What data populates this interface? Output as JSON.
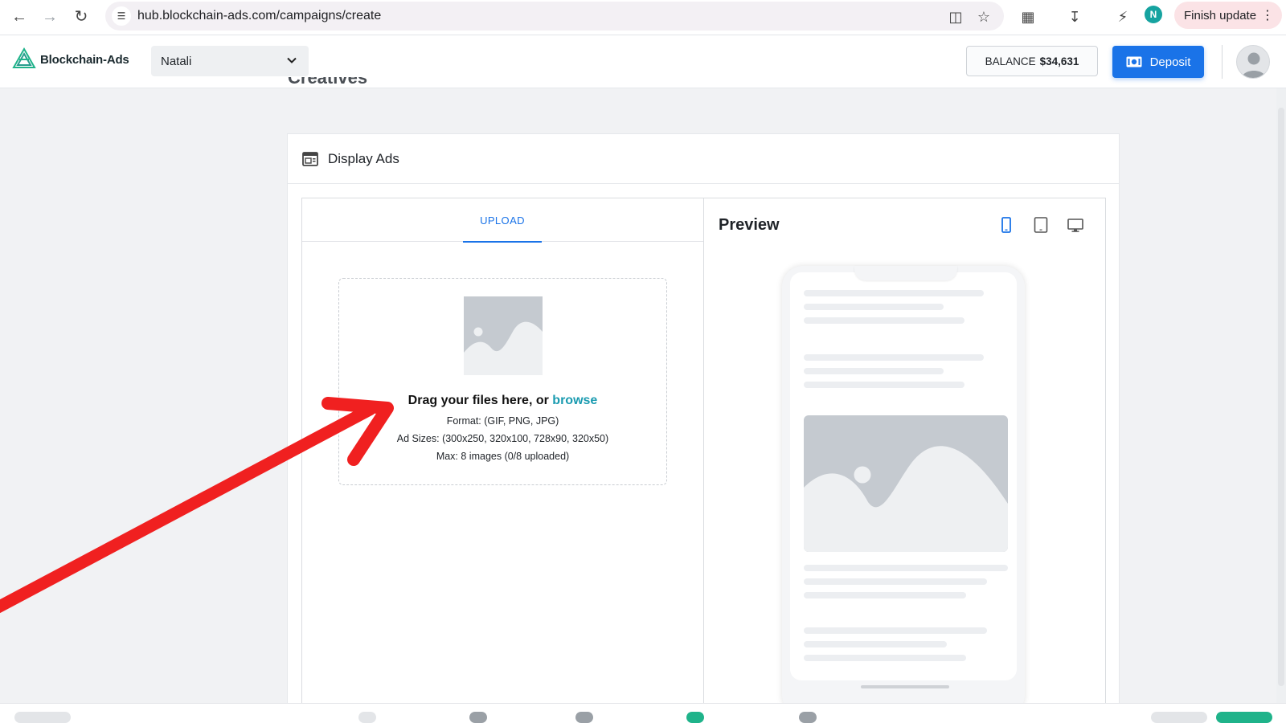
{
  "browser": {
    "url": "hub.blockchain-ads.com/campaigns/create",
    "profile_initial": "N",
    "finish_update_label": "Finish update"
  },
  "header": {
    "brand": "Blockchain-Ads",
    "account": "Natali",
    "balance_label": "BALANCE",
    "balance_value": "$34,631",
    "deposit_label": "Deposit"
  },
  "section": {
    "heading_partial": "Creatives"
  },
  "card": {
    "title": "Display Ads",
    "tabs": [
      {
        "label": "UPLOAD",
        "active": true
      }
    ],
    "upload": {
      "title_prefix": "Drag your files here, or",
      "browse_label": "browse",
      "format": "Format: (GIF, PNG, JPG)",
      "ad_sizes": "Ad Sizes: (300x250, 320x100, 728x90, 320x50)",
      "max": "Max: 8 images (0/8 uploaded)"
    },
    "preview": {
      "title": "Preview",
      "devices": [
        "mobile-icon",
        "tablet-icon",
        "desktop-icon"
      ],
      "active_device": "mobile-icon"
    }
  },
  "colors": {
    "accent": "#1a73e8",
    "browse_link": "#1a9bb0",
    "annotation_arrow": "#f02020"
  }
}
